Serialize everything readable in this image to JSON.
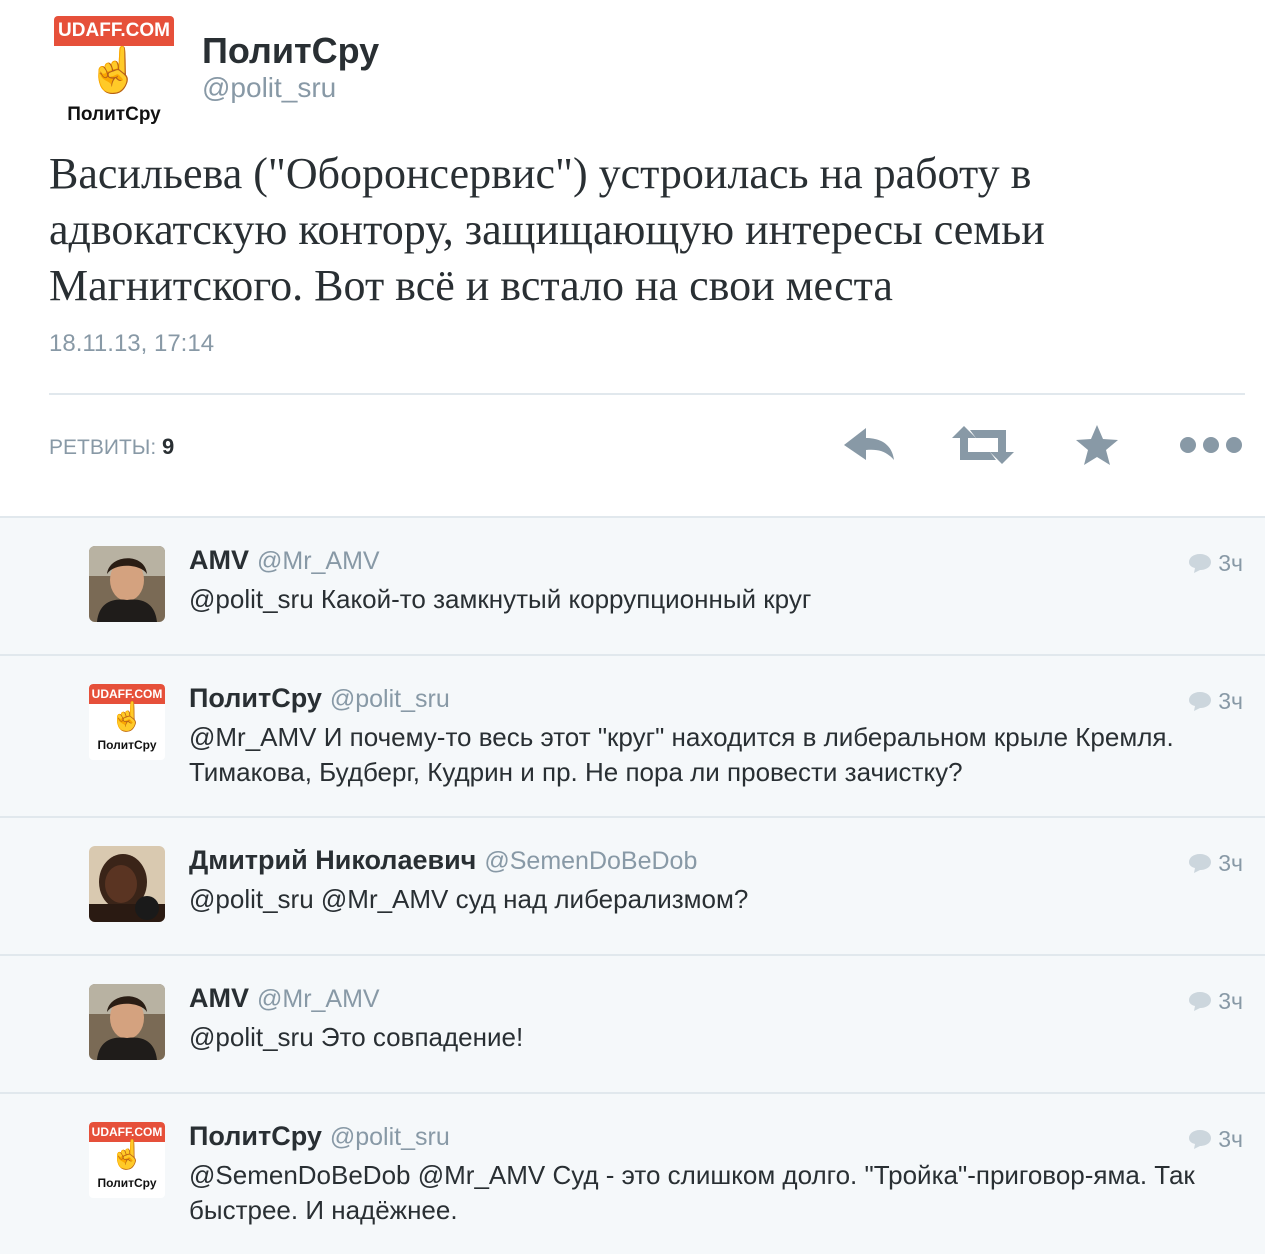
{
  "main_tweet": {
    "logo": {
      "top": "UDAFF.COM",
      "bottom": "ПолитСру",
      "icon": "middle-finger-hand-icon"
    },
    "name": "ПолитСру",
    "handle": "@polit_sru",
    "text": "Васильева (\"Оборонсервис\") устроилась на работу в адвокатскую контору, защищающую интересы семьи Магнитского. Вот всё и встало на свои места",
    "timestamp": "18.11.13, 17:14",
    "retweets_label": "РЕТВИТЫ:",
    "retweets_count": "9",
    "actions": [
      "reply-icon",
      "retweet-icon",
      "favorite-star-icon",
      "more-dots-icon"
    ],
    "colors": {
      "accent_gray": "#8899a6",
      "icon_gray": "#8899a6"
    }
  },
  "replies": [
    {
      "name": "AMV",
      "handle": "@Mr_AMV",
      "text": "@polit_sru Какой-то замкнутый коррупционный круг",
      "time": "3ч",
      "avatar": "photo"
    },
    {
      "name": "ПолитСру",
      "handle": "@polit_sru",
      "text": "@Mr_AMV И почему-то весь этот \"круг\" находится в либеральном крыле Кремля. Тимакова, Будберг, Кудрин и пр. Не пора ли провести зачистку?",
      "time": "3ч",
      "avatar": "udaff",
      "logo_top": "UDAFF.COM",
      "logo_bottom": "ПолитСру"
    },
    {
      "name": "Дмитрий Николаевич",
      "handle": "@SemenDoBeDob",
      "text": "@polit_sru @Mr_AMV суд над либерализмом?",
      "time": "3ч",
      "avatar": "photo-dark"
    },
    {
      "name": "AMV",
      "handle": "@Mr_AMV",
      "text": "@polit_sru Это совпадение!",
      "time": "3ч",
      "avatar": "photo"
    },
    {
      "name": "ПолитСру",
      "handle": "@polit_sru",
      "text": "@SemenDoBeDob @Mr_AMV Суд - это слишком долго. \"Тройка\"-приговор-яма. Так быстрее. И надёжнее.",
      "time": "3ч",
      "avatar": "udaff",
      "logo_top": "UDAFF.COM",
      "logo_bottom": "ПолитСру"
    }
  ]
}
